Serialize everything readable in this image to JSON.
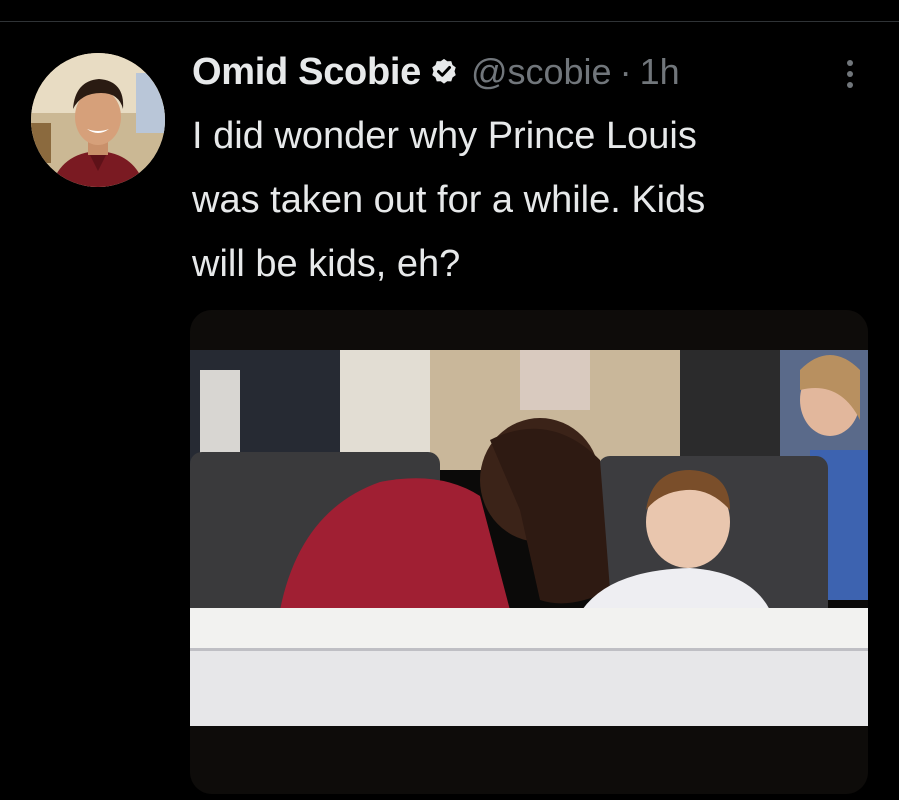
{
  "tweet": {
    "author": {
      "display_name": "Omid Scobie",
      "handle": "@scobie",
      "verified": true
    },
    "separator": "·",
    "time": "1h",
    "text": "I did wonder why Prince Louis\nwas taken out for a while. Kids\nwill be kids, eh?",
    "media": {
      "type": "video-still"
    }
  },
  "icons": {
    "verified": "verified-badge-icon",
    "more": "more-options-icon"
  },
  "colors": {
    "background": "#000000",
    "text": "#e7e9ea",
    "muted": "#71767b",
    "divider": "#2f3336"
  }
}
